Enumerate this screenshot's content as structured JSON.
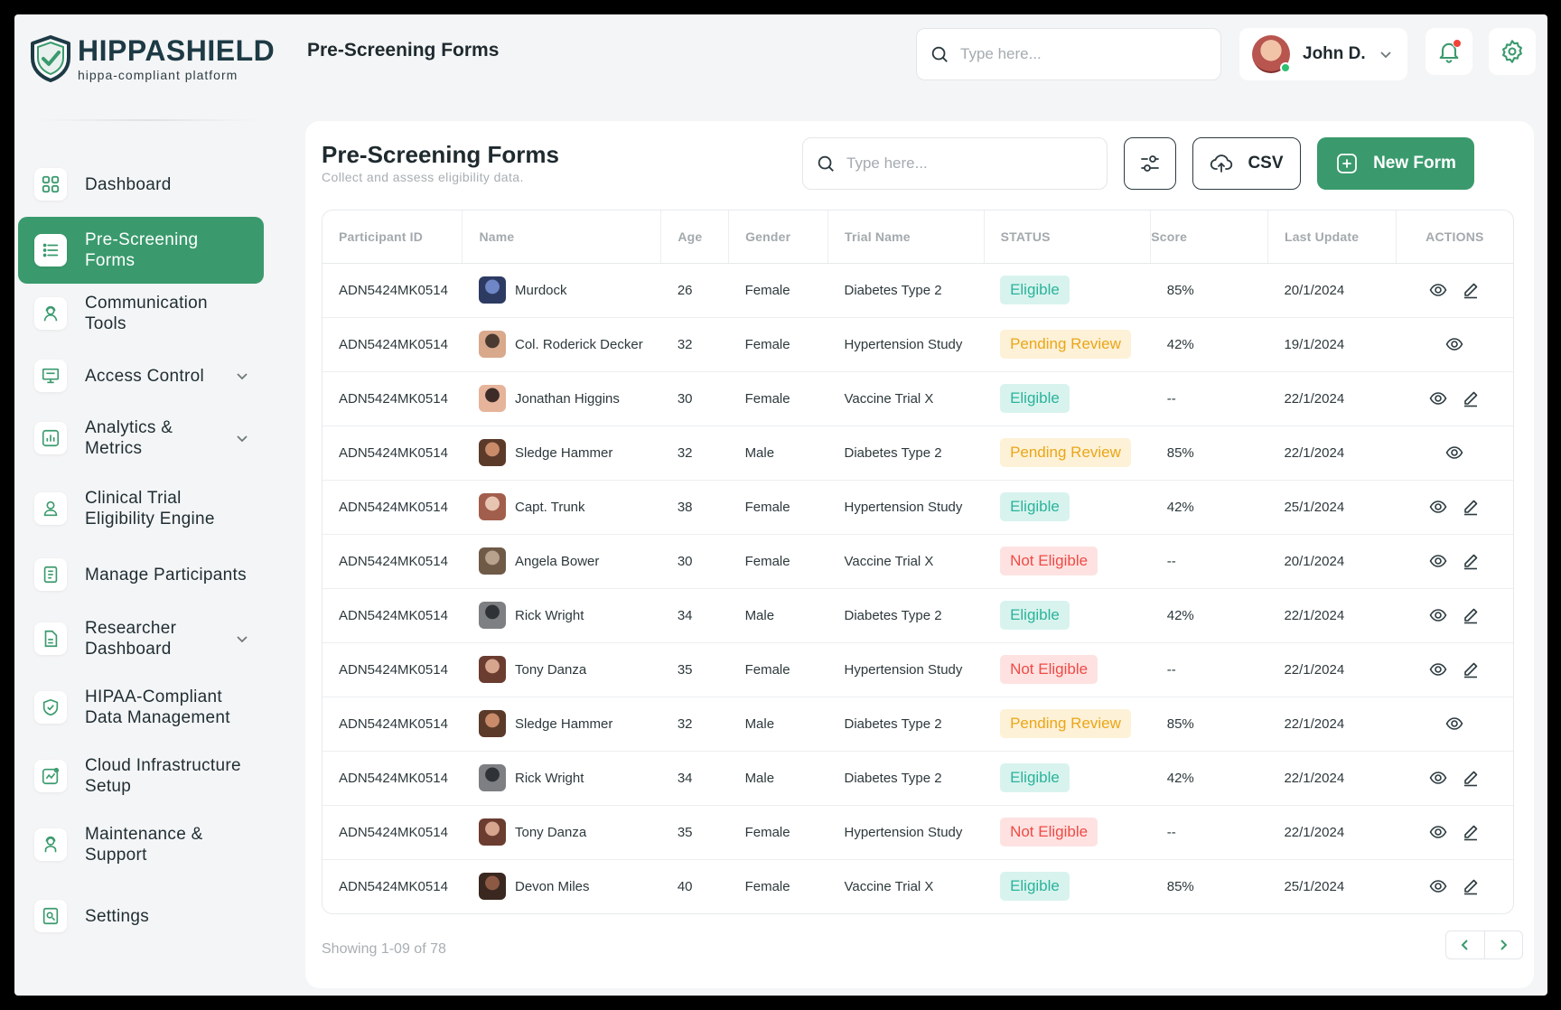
{
  "brand": {
    "name": "HIPPASHIELD",
    "tagline": "hippa-compliant platform"
  },
  "colors": {
    "accent": "#3a9a6d",
    "eligible": "#2ab39a",
    "pending": "#eaa618",
    "not_eligible": "#ee4b45"
  },
  "sidebar": {
    "items": [
      {
        "label": "Dashboard",
        "icon": "grid-icon"
      },
      {
        "label": "Pre-Screening Forms",
        "icon": "list-icon",
        "active": true
      },
      {
        "label": "Communication Tools",
        "icon": "agent-icon"
      },
      {
        "label": "Access Control",
        "icon": "monitor-icon",
        "expandable": true
      },
      {
        "label": "Analytics & Metrics",
        "icon": "chart-icon",
        "expandable": true
      },
      {
        "label": "Clinical Trial Eligibility Engine",
        "icon": "user-icon"
      },
      {
        "label": "Manage Participants",
        "icon": "document-icon"
      },
      {
        "label": "Researcher Dashboard",
        "icon": "file-icon",
        "expandable": true
      },
      {
        "label": "HIPAA-Compliant Data Management",
        "icon": "shield-check-icon"
      },
      {
        "label": "Cloud Infrastructure Setup",
        "icon": "trend-icon"
      },
      {
        "label": "Maintenance & Support",
        "icon": "support-icon"
      },
      {
        "label": "Settings",
        "icon": "settings-icon"
      }
    ]
  },
  "header": {
    "title": "Pre-Screening Forms",
    "search_placeholder": "Type here...",
    "user_name": "John D."
  },
  "card": {
    "title": "Pre-Screening Forms",
    "subtitle": "Collect and assess eligibility data.",
    "search_placeholder": "Type here...",
    "csv_label": "CSV",
    "new_form_label": "New Form"
  },
  "table": {
    "columns": [
      "Participant ID",
      "Name",
      "Age",
      "Gender",
      "Trial Name",
      "STATUS",
      "Score",
      "Last Update",
      "ACTIONS"
    ],
    "rows": [
      {
        "id": "ADN5424MK0514",
        "name": "Murdock",
        "age": "26",
        "gender": "Female",
        "trial": "Diabetes Type 2",
        "status": "Eligible",
        "score": "85%",
        "updated": "20/1/2024",
        "editable": true
      },
      {
        "id": "ADN5424MK0514",
        "name": "Col. Roderick Decker",
        "age": "32",
        "gender": "Female",
        "trial": "Hypertension Study",
        "status": "Pending Review",
        "score": "42%",
        "updated": "19/1/2024",
        "editable": false
      },
      {
        "id": "ADN5424MK0514",
        "name": "Jonathan Higgins",
        "age": "30",
        "gender": "Female",
        "trial": "Vaccine Trial X",
        "status": "Eligible",
        "score": "--",
        "updated": "22/1/2024",
        "editable": true
      },
      {
        "id": "ADN5424MK0514",
        "name": "Sledge Hammer",
        "age": "32",
        "gender": "Male",
        "trial": "Diabetes Type 2",
        "status": "Pending Review",
        "score": "85%",
        "updated": "22/1/2024",
        "editable": false
      },
      {
        "id": "ADN5424MK0514",
        "name": "Capt. Trunk",
        "age": "38",
        "gender": "Female",
        "trial": "Hypertension Study",
        "status": "Eligible",
        "score": "42%",
        "updated": "25/1/2024",
        "editable": true
      },
      {
        "id": "ADN5424MK0514",
        "name": "Angela Bower",
        "age": "30",
        "gender": "Female",
        "trial": "Vaccine Trial X",
        "status": "Not Eligible",
        "score": "--",
        "updated": "20/1/2024",
        "editable": true
      },
      {
        "id": "ADN5424MK0514",
        "name": "Rick Wright",
        "age": "34",
        "gender": "Male",
        "trial": "Diabetes Type 2",
        "status": "Eligible",
        "score": "42%",
        "updated": "22/1/2024",
        "editable": true
      },
      {
        "id": "ADN5424MK0514",
        "name": "Tony Danza",
        "age": "35",
        "gender": "Female",
        "trial": "Hypertension Study",
        "status": "Not Eligible",
        "score": "--",
        "updated": "22/1/2024",
        "editable": true
      },
      {
        "id": "ADN5424MK0514",
        "name": "Sledge Hammer",
        "age": "32",
        "gender": "Male",
        "trial": "Diabetes Type 2",
        "status": "Pending Review",
        "score": "85%",
        "updated": "22/1/2024",
        "editable": false
      },
      {
        "id": "ADN5424MK0514",
        "name": "Rick Wright",
        "age": "34",
        "gender": "Male",
        "trial": "Diabetes Type 2",
        "status": "Eligible",
        "score": "42%",
        "updated": "22/1/2024",
        "editable": true
      },
      {
        "id": "ADN5424MK0514",
        "name": "Tony Danza",
        "age": "35",
        "gender": "Female",
        "trial": "Hypertension Study",
        "status": "Not Eligible",
        "score": "--",
        "updated": "22/1/2024",
        "editable": true
      },
      {
        "id": "ADN5424MK0514",
        "name": "Devon Miles",
        "age": "40",
        "gender": "Female",
        "trial": "Vaccine Trial X",
        "status": "Eligible",
        "score": "85%",
        "updated": "25/1/2024",
        "editable": true
      }
    ]
  },
  "pagination": {
    "summary": "Showing 1-09 of 78"
  }
}
